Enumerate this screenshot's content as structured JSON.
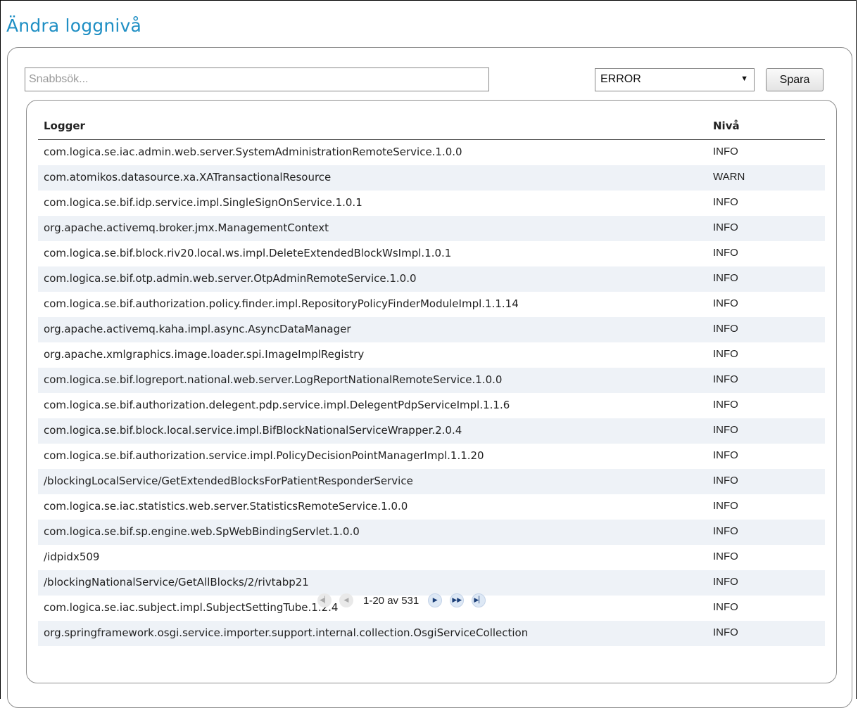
{
  "page": {
    "title": "Ändra loggnivå"
  },
  "toolbar": {
    "search_placeholder": "Snabbsök...",
    "level_selected": "ERROR",
    "save_label": "Spara"
  },
  "table": {
    "headers": {
      "logger": "Logger",
      "level": "Nivå"
    },
    "rows": [
      {
        "logger": "com.logica.se.iac.admin.web.server.SystemAdministrationRemoteService.1.0.0",
        "level": "INFO"
      },
      {
        "logger": "com.atomikos.datasource.xa.XATransactionalResource",
        "level": "WARN"
      },
      {
        "logger": "com.logica.se.bif.idp.service.impl.SingleSignOnService.1.0.1",
        "level": "INFO"
      },
      {
        "logger": "org.apache.activemq.broker.jmx.ManagementContext",
        "level": "INFO"
      },
      {
        "logger": "com.logica.se.bif.block.riv20.local.ws.impl.DeleteExtendedBlockWsImpl.1.0.1",
        "level": "INFO"
      },
      {
        "logger": "com.logica.se.bif.otp.admin.web.server.OtpAdminRemoteService.1.0.0",
        "level": "INFO"
      },
      {
        "logger": "com.logica.se.bif.authorization.policy.finder.impl.RepositoryPolicyFinderModuleImpl.1.1.14",
        "level": "INFO"
      },
      {
        "logger": "org.apache.activemq.kaha.impl.async.AsyncDataManager",
        "level": "INFO"
      },
      {
        "logger": "org.apache.xmlgraphics.image.loader.spi.ImageImplRegistry",
        "level": "INFO"
      },
      {
        "logger": "com.logica.se.bif.logreport.national.web.server.LogReportNationalRemoteService.1.0.0",
        "level": "INFO"
      },
      {
        "logger": "com.logica.se.bif.authorization.delegent.pdp.service.impl.DelegentPdpServiceImpl.1.1.6",
        "level": "INFO"
      },
      {
        "logger": "com.logica.se.bif.block.local.service.impl.BifBlockNationalServiceWrapper.2.0.4",
        "level": "INFO"
      },
      {
        "logger": "com.logica.se.bif.authorization.service.impl.PolicyDecisionPointManagerImpl.1.1.20",
        "level": "INFO"
      },
      {
        "logger": "/blockingLocalService/GetExtendedBlocksForPatientResponderService",
        "level": "INFO"
      },
      {
        "logger": "com.logica.se.iac.statistics.web.server.StatisticsRemoteService.1.0.0",
        "level": "INFO"
      },
      {
        "logger": "com.logica.se.bif.sp.engine.web.SpWebBindingServlet.1.0.0",
        "level": "INFO"
      },
      {
        "logger": "/idpidx509",
        "level": "INFO"
      },
      {
        "logger": "/blockingNationalService/GetAllBlocks/2/rivtabp21",
        "level": "INFO"
      },
      {
        "logger": "com.logica.se.iac.subject.impl.SubjectSettingTube.1.2.4",
        "level": "INFO"
      },
      {
        "logger": "org.springframework.osgi.service.importer.support.internal.collection.OsgiServiceCollection",
        "level": "INFO"
      }
    ]
  },
  "pager": {
    "range_text": "1-20 av 531",
    "icons": [
      "first-page-icon",
      "prev-page-icon",
      "next-page-icon",
      "fast-forward-icon",
      "last-page-icon"
    ]
  },
  "colors": {
    "title": "#1f8fc4",
    "alt_row": "#eef2f7"
  }
}
